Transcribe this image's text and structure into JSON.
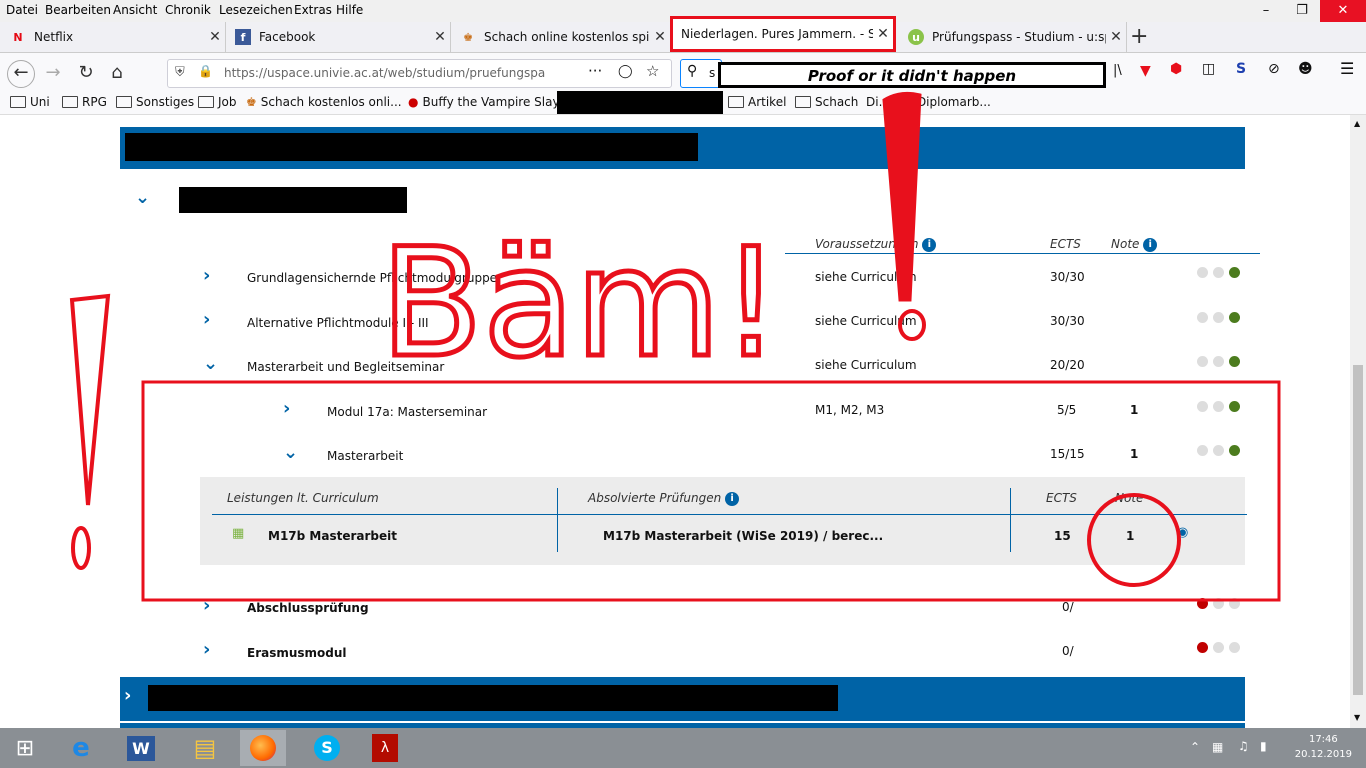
{
  "menu": [
    "Datei",
    "Bearbeiten",
    "Ansicht",
    "Chronik",
    "Lesezeichen",
    "Extras",
    "Hilfe"
  ],
  "tabs": [
    {
      "title": "Netflix",
      "icon": "netflix-icon"
    },
    {
      "title": "Facebook",
      "icon": "facebook-icon"
    },
    {
      "title": "Schach online kostenlos spielen",
      "icon": "chess-icon"
    },
    {
      "title": "Niederlagen. Pures Jammern. - Seite",
      "icon": "page-icon",
      "active": true
    },
    {
      "title": "Prüfungspass - Studium - u:spa",
      "icon": "uspace-icon"
    }
  ],
  "url": "https://uspace.univie.ac.at/web/studium/pruefungspa",
  "url_domain": "uspace.univie.ac.at",
  "search_value": "s",
  "bookmarks": [
    "Uni",
    "RPG",
    "Sonstiges",
    "Job",
    "Schach kostenlos onli...",
    "Buffy the Vampire Slay...",
    "Artikel",
    "Schach",
    "Di... um Diplomarb..."
  ],
  "annotation": {
    "caption": "Proof or it didn't happen",
    "big_text": "Bäm!"
  },
  "table": {
    "headers": {
      "prereq": "Voraussetzungen",
      "ects": "ECTS",
      "grade": "Note"
    },
    "rows": [
      {
        "label": "Grundlagensichernde Pflichtmodulgruppe",
        "prereq": "siehe Curriculum",
        "ects": "30/30",
        "status": "green"
      },
      {
        "label": "Alternative Pflichtmodule I - III",
        "prereq": "siehe Curriculum",
        "ects": "30/30",
        "status": "green"
      },
      {
        "label": "Masterarbeit und Begleitseminar",
        "prereq": "siehe Curriculum",
        "ects": "20/20",
        "status": "green"
      }
    ],
    "subrows": [
      {
        "label": "Modul 17a: Masterseminar",
        "prereq": "M1, M2, M3",
        "ects": "5/5",
        "grade": "1",
        "status": "green"
      },
      {
        "label": "Masterarbeit",
        "prereq": "",
        "ects": "15/15",
        "grade": "1",
        "status": "green"
      }
    ],
    "detail": {
      "headers": {
        "curriculum": "Leistungen lt. Curriculum",
        "exams": "Absolvierte Prüfungen",
        "ects": "ECTS",
        "grade": "Note"
      },
      "row": {
        "course": "M17b Masterarbeit",
        "exam": "M17b Masterarbeit (WiSe 2019) / berec...",
        "ects": "15",
        "grade": "1"
      }
    },
    "after_rows": [
      {
        "label": "Abschlussprüfung",
        "ects": "0/",
        "status": "red"
      },
      {
        "label": "Erasmusmodul",
        "ects": "0/",
        "status": "red"
      }
    ]
  },
  "clock": {
    "time": "17:46",
    "date": "20.12.2019"
  },
  "colors": {
    "accent": "#0063a6",
    "annotation_red": "#e8101c",
    "ok_green": "#4c7c1e",
    "fail_red": "#c00000"
  }
}
